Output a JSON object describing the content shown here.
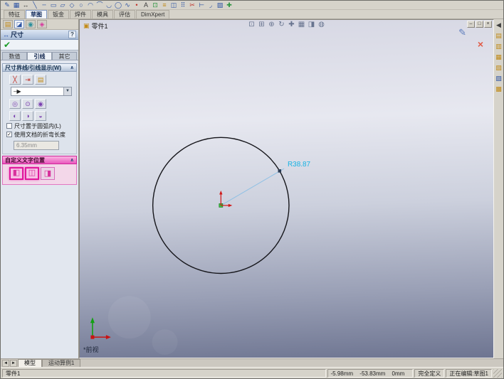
{
  "ui": {
    "caret": "▼",
    "chevron": "∧",
    "check_glyph": "✔",
    "check_small": "✓",
    "help_glyph": "?",
    "min_glyph": "–",
    "restore_glyph": "□",
    "close_glyph": "×",
    "cancel_glyph": "×",
    "exit_sketch_glyph": "✎",
    "nav_left": "◄",
    "nav_right": "►"
  },
  "toolbars": {
    "sketch_icons": [
      {
        "name": "sketch-icon",
        "glyph": "✎",
        "cls": "c-blue"
      },
      {
        "name": "grid-icon",
        "glyph": "▦",
        "cls": "c-blue"
      },
      {
        "name": "smart-dimension-icon",
        "glyph": "↔",
        "cls": "c-dark"
      },
      {
        "name": "line-icon",
        "glyph": "╲",
        "cls": "c-blue"
      },
      {
        "name": "centerline-icon",
        "glyph": "╌",
        "cls": "c-blue"
      },
      {
        "name": "rectangle-icon",
        "glyph": "▭",
        "cls": "c-blue"
      },
      {
        "name": "parallelogram-icon",
        "glyph": "▱",
        "cls": "c-blue"
      },
      {
        "name": "polygon-icon",
        "glyph": "◇",
        "cls": "c-blue"
      },
      {
        "name": "circle-icon",
        "glyph": "○",
        "cls": "c-blue"
      },
      {
        "name": "centerpoint-arc-icon",
        "glyph": "◠",
        "cls": "c-blue"
      },
      {
        "name": "tangent-arc-icon",
        "glyph": "⌒",
        "cls": "c-blue"
      },
      {
        "name": "three-point-arc-icon",
        "glyph": "◡",
        "cls": "c-blue"
      },
      {
        "name": "ellipse-icon",
        "glyph": "◯",
        "cls": "c-blue"
      },
      {
        "name": "spline-icon",
        "glyph": "∿",
        "cls": "c-blue"
      },
      {
        "name": "point-icon",
        "glyph": "•",
        "cls": "c-red"
      },
      {
        "name": "text-icon",
        "glyph": "A",
        "cls": "c-dark"
      },
      {
        "name": "convert-entities-icon",
        "glyph": "⊡",
        "cls": "c-green"
      },
      {
        "name": "offset-entities-icon",
        "glyph": "≡",
        "cls": "c-gold"
      },
      {
        "name": "mirror-entities-icon",
        "glyph": "◫",
        "cls": "c-blue"
      },
      {
        "name": "linear-pattern-icon",
        "glyph": "⠿",
        "cls": "c-blue"
      },
      {
        "name": "trim-entities-icon",
        "glyph": "✂",
        "cls": "c-red"
      },
      {
        "name": "extend-entities-icon",
        "glyph": "⊢",
        "cls": "c-blue"
      },
      {
        "name": "fillet-entities-icon",
        "glyph": "◞",
        "cls": "c-blue"
      },
      {
        "name": "construction-geometry-icon",
        "glyph": "▨",
        "cls": "c-blue"
      },
      {
        "name": "move-entities-icon",
        "glyph": "✚",
        "cls": "c-green"
      }
    ],
    "tabs": [
      {
        "label": "特征",
        "state": ""
      },
      {
        "label": "草图",
        "state": "active"
      },
      {
        "label": "钣金",
        "state": ""
      },
      {
        "label": "焊件",
        "state": ""
      },
      {
        "label": "模具",
        "state": ""
      },
      {
        "label": "评估",
        "state": ""
      },
      {
        "label": "DimXpert",
        "state": ""
      }
    ]
  },
  "panel": {
    "manager_tabs": [
      {
        "name": "featuremanager-tab-icon",
        "glyph": "▤",
        "cls": "c-gold",
        "state": ""
      },
      {
        "name": "propertymanager-tab-icon",
        "glyph": "◪",
        "cls": "c-blue",
        "state": "active"
      },
      {
        "name": "configurationmanager-tab-icon",
        "glyph": "◉",
        "cls": "c-teal",
        "state": ""
      },
      {
        "name": "dimxpertmanager-tab-icon",
        "glyph": "◈",
        "cls": "c-pink",
        "state": ""
      }
    ],
    "title": "尺寸",
    "title_icon": "↔",
    "tabs": [
      {
        "label": "数值",
        "state": ""
      },
      {
        "label": "引线",
        "state": "active"
      },
      {
        "label": "其它",
        "state": ""
      }
    ],
    "group_witness": {
      "title": "尺寸界线/引线显示(W)",
      "arrow_buttons": [
        {
          "name": "witness-break-icon",
          "glyph": "╳",
          "cls": "c-red",
          "state": ""
        },
        {
          "name": "leader-arrow-icon",
          "glyph": "⇥",
          "cls": "c-red",
          "state": ""
        },
        {
          "name": "document-default-icon",
          "glyph": "▤",
          "cls": "c-gold",
          "state": ""
        }
      ],
      "style_value": "–▶",
      "radial_row1": [
        {
          "name": "radius-leader-outside-icon",
          "glyph": "◎",
          "cls": "c-violet",
          "state": ""
        },
        {
          "name": "radius-leader-inside-icon",
          "glyph": "⊙",
          "cls": "c-violet",
          "state": ""
        },
        {
          "name": "radius-leader-broken-icon",
          "glyph": "◉",
          "cls": "c-violet",
          "state": ""
        }
      ],
      "radial_row2": [
        {
          "name": "radius-leader-open-icon",
          "glyph": "◐",
          "cls": "c-violet",
          "state": ""
        },
        {
          "name": "radius-leader-solid-icon",
          "glyph": "◑",
          "cls": "c-violet",
          "state": ""
        },
        {
          "name": "radius-leader-smart-icon",
          "glyph": "◒",
          "cls": "c-violet",
          "state": ""
        }
      ],
      "checkbox_arc": {
        "label": "尺寸置于圆弧内(L)",
        "checked": false
      },
      "checkbox_bend": {
        "label": "使用文档的折弯长度",
        "checked": true
      },
      "bend_length": "6.35mm"
    },
    "group_text_position": {
      "title": "自定义文字位置",
      "buttons": [
        {
          "name": "text-position-left-icon",
          "glyph": "◧",
          "cls": "c-pink",
          "state": "sel"
        },
        {
          "name": "text-position-center-icon",
          "glyph": "◫",
          "cls": "c-pink",
          "state": "sel"
        },
        {
          "name": "text-position-right-icon",
          "glyph": "◨",
          "cls": "c-pink",
          "state": ""
        }
      ]
    }
  },
  "canvas": {
    "doc_title": "零件1",
    "view_icons": [
      {
        "name": "zoom-fit-icon",
        "glyph": "⊡"
      },
      {
        "name": "zoom-area-icon",
        "glyph": "⊞"
      },
      {
        "name": "zoom-in-out-icon",
        "glyph": "⊕"
      },
      {
        "name": "rotate-view-icon",
        "glyph": "↻"
      },
      {
        "name": "pan-icon",
        "glyph": "✚"
      },
      {
        "name": "view-orientation-icon",
        "glyph": "▦"
      },
      {
        "name": "display-style-icon",
        "glyph": "◨"
      },
      {
        "name": "hide-show-icon",
        "glyph": "◍"
      }
    ],
    "dimension_label": "R38.87",
    "view_label": "*前视"
  },
  "taskpane": {
    "icons": [
      {
        "name": "collapse-taskpane-icon",
        "glyph": "◀",
        "cls": "c-dark"
      },
      {
        "name": "resources-icon",
        "glyph": "▤",
        "cls": "c-gold"
      },
      {
        "name": "design-library-icon",
        "glyph": "▥",
        "cls": "c-gold"
      },
      {
        "name": "file-explorer-icon",
        "glyph": "▦",
        "cls": "c-gold"
      },
      {
        "name": "view-palette-icon",
        "glyph": "▧",
        "cls": "c-gold"
      },
      {
        "name": "appearances-icon",
        "glyph": "▨",
        "cls": "c-blue"
      },
      {
        "name": "custom-properties-icon",
        "glyph": "▩",
        "cls": "c-gold"
      }
    ]
  },
  "doc_tabs": {
    "tabs": [
      {
        "label": "模型",
        "state": "active"
      },
      {
        "label": "运动算例1",
        "state": ""
      }
    ]
  },
  "statusbar": {
    "doc": "零件1",
    "x": "-5.98mm",
    "y": "-53.83mm",
    "z": "0mm",
    "defined": "完全定义",
    "editing": "正在编辑:草图1"
  }
}
